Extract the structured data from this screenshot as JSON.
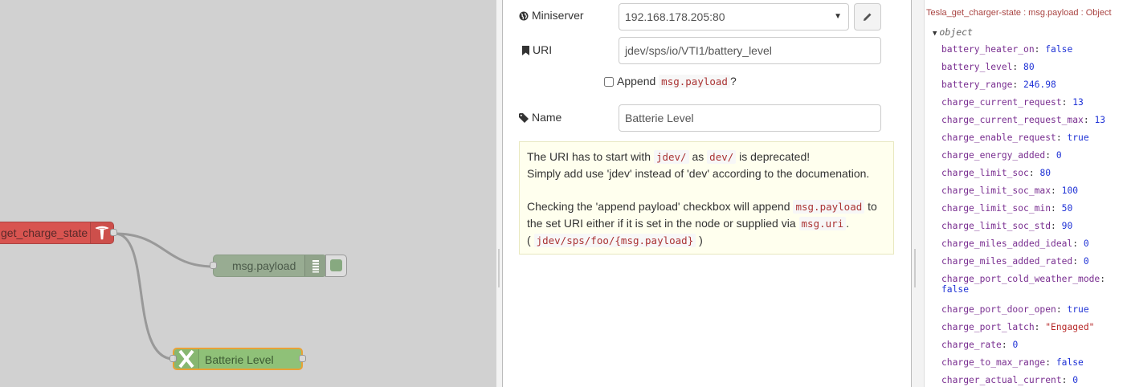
{
  "workspace": {
    "nodes": {
      "tesla": {
        "label": "get_charge_state",
        "icon": "tesla-logo-icon"
      },
      "debug": {
        "label": "msg.payload",
        "icon": "list-icon"
      },
      "loxone": {
        "label": "Batterie Level",
        "icon": "loxone-x-icon"
      }
    },
    "colors": {
      "background": "#d1d1d1",
      "tesla_node": "#d85450",
      "debug_node": "#98ac92",
      "loxone_node": "#8fc178",
      "selected_outline": "#e8a136"
    }
  },
  "editor": {
    "miniserver": {
      "label": "Miniserver",
      "value": "192.168.178.205:80"
    },
    "uri": {
      "label": "URI",
      "value": "jdev/sps/io/VTI1/battery_level"
    },
    "append": {
      "label": "Append",
      "code": "msg.payload",
      "suffix": "?"
    },
    "name": {
      "label": "Name",
      "value": "Batterie Level"
    },
    "tip": {
      "p1_a": "The URI has to start with ",
      "p1_code1": "jdev/",
      "p1_b": " as ",
      "p1_code2": "dev/",
      "p1_c": " is deprecated!",
      "p1_line2": "Simply add use 'jdev' instead of 'dev' according to the documenation.",
      "p2_a": "Checking the 'append payload' checkbox will append ",
      "p2_code1": "msg.payload",
      "p2_b": " to the set URI either if it is set in the node or supplied via ",
      "p2_code2": "msg.uri",
      "p2_c": ".",
      "p2_open": "( ",
      "p2_code3": "jdev/sps/foo/{msg.payload}",
      "p2_close": " )"
    }
  },
  "debug": {
    "topic": "Tesla_get_charger-state : msg.payload : Object",
    "root": "object",
    "props": [
      {
        "k": "battery_heater_on",
        "v": "false",
        "t": "bool"
      },
      {
        "k": "battery_level",
        "v": "80",
        "t": "num"
      },
      {
        "k": "battery_range",
        "v": "246.98",
        "t": "num"
      },
      {
        "k": "charge_current_request",
        "v": "13",
        "t": "num"
      },
      {
        "k": "charge_current_request_max",
        "v": "13",
        "t": "num"
      },
      {
        "k": "charge_enable_request",
        "v": "true",
        "t": "bool"
      },
      {
        "k": "charge_energy_added",
        "v": "0",
        "t": "num"
      },
      {
        "k": "charge_limit_soc",
        "v": "80",
        "t": "num"
      },
      {
        "k": "charge_limit_soc_max",
        "v": "100",
        "t": "num"
      },
      {
        "k": "charge_limit_soc_min",
        "v": "50",
        "t": "num"
      },
      {
        "k": "charge_limit_soc_std",
        "v": "90",
        "t": "num"
      },
      {
        "k": "charge_miles_added_ideal",
        "v": "0",
        "t": "num"
      },
      {
        "k": "charge_miles_added_rated",
        "v": "0",
        "t": "num"
      },
      {
        "k": "charge_port_cold_weather_mode",
        "v": "false",
        "t": "bool"
      },
      {
        "k": "charge_port_door_open",
        "v": "true",
        "t": "bool"
      },
      {
        "k": "charge_port_latch",
        "v": "\"Engaged\"",
        "t": "str"
      },
      {
        "k": "charge_rate",
        "v": "0",
        "t": "num"
      },
      {
        "k": "charge_to_max_range",
        "v": "false",
        "t": "bool"
      },
      {
        "k": "charger_actual_current",
        "v": "0",
        "t": "num"
      }
    ]
  }
}
